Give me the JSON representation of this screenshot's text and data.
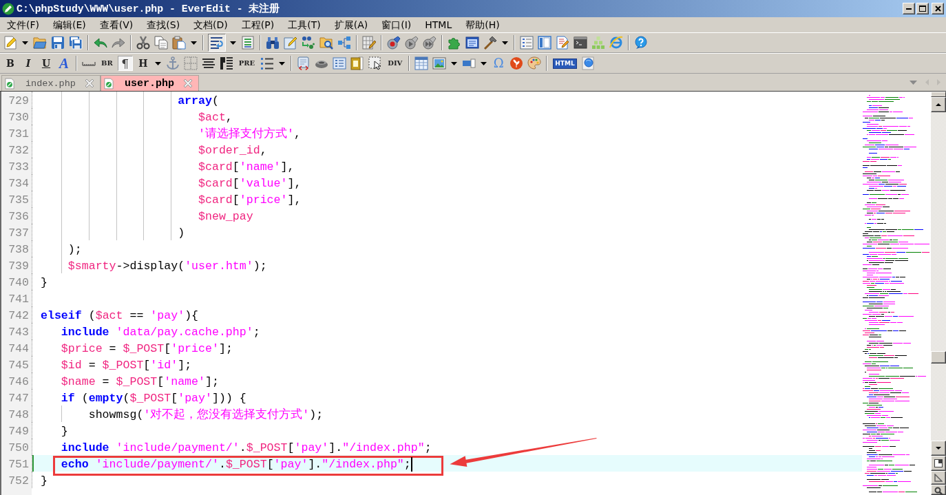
{
  "window": {
    "title": "C:\\phpStudy\\WWW\\user.php - EverEdit - 未注册"
  },
  "menu": [
    "文件(F)",
    "编辑(E)",
    "查看(V)",
    "查找(S)",
    "文档(D)",
    "工程(P)",
    "工具(T)",
    "扩展(A)",
    "窗口(I)",
    "HTML",
    "帮助(H)"
  ],
  "toolbar": {
    "wrap_toggle": {
      "pressed": true
    }
  },
  "format_toolbar": {
    "buttons": [
      {
        "label": "B",
        "pressed": false
      },
      {
        "label": "I",
        "pressed": false
      },
      {
        "label": "U",
        "pressed": false
      },
      {
        "label": "A",
        "pressed": false
      },
      {
        "label": "BR",
        "pressed": false
      },
      {
        "label": "¶",
        "pressed": true
      },
      {
        "label": "H",
        "pressed": false
      },
      {
        "label": "PRE",
        "pressed": false
      },
      {
        "label": "DIV",
        "pressed": false
      },
      {
        "label": "Ω",
        "pressed": false
      },
      {
        "label": "HTML",
        "pressed": false
      }
    ]
  },
  "tabs": [
    {
      "label": "index.php",
      "selected": false
    },
    {
      "label": "user.php",
      "selected": true
    }
  ],
  "editor": {
    "lines": [
      {
        "number": "729",
        "current": false,
        "callout": false,
        "tokens": [
          {
            "kind": "keyword",
            "text": "                    array"
          },
          {
            "kind": "plain",
            "text": "("
          }
        ]
      },
      {
        "number": "730",
        "current": false,
        "callout": false,
        "tokens": [
          {
            "kind": "variable",
            "text": "                       $act"
          },
          {
            "kind": "plain",
            "text": ","
          }
        ]
      },
      {
        "number": "731",
        "current": false,
        "callout": false,
        "tokens": [
          {
            "kind": "string",
            "text": "                       '请选择支付方式'"
          },
          {
            "kind": "plain",
            "text": ","
          }
        ]
      },
      {
        "number": "732",
        "current": false,
        "callout": false,
        "tokens": [
          {
            "kind": "variable",
            "text": "                       $order_id"
          },
          {
            "kind": "plain",
            "text": ","
          }
        ]
      },
      {
        "number": "733",
        "current": false,
        "callout": false,
        "tokens": [
          {
            "kind": "variable",
            "text": "                       $card"
          },
          {
            "kind": "plain",
            "text": "["
          },
          {
            "kind": "string",
            "text": "'name'"
          },
          {
            "kind": "plain",
            "text": "],"
          }
        ]
      },
      {
        "number": "734",
        "current": false,
        "callout": false,
        "tokens": [
          {
            "kind": "variable",
            "text": "                       $card"
          },
          {
            "kind": "plain",
            "text": "["
          },
          {
            "kind": "string",
            "text": "'value'"
          },
          {
            "kind": "plain",
            "text": "],"
          }
        ]
      },
      {
        "number": "735",
        "current": false,
        "callout": false,
        "tokens": [
          {
            "kind": "variable",
            "text": "                       $card"
          },
          {
            "kind": "plain",
            "text": "["
          },
          {
            "kind": "string",
            "text": "'price'"
          },
          {
            "kind": "plain",
            "text": "],"
          }
        ]
      },
      {
        "number": "736",
        "current": false,
        "callout": false,
        "tokens": [
          {
            "kind": "variable",
            "text": "                       $new_pay"
          }
        ]
      },
      {
        "number": "737",
        "current": false,
        "callout": false,
        "tokens": [
          {
            "kind": "plain",
            "text": "                    )"
          }
        ]
      },
      {
        "number": "738",
        "current": false,
        "callout": false,
        "tokens": [
          {
            "kind": "plain",
            "text": "    );"
          }
        ]
      },
      {
        "number": "739",
        "current": false,
        "callout": false,
        "tokens": [
          {
            "kind": "variable",
            "text": "    $smarty"
          },
          {
            "kind": "plain",
            "text": "->display("
          },
          {
            "kind": "string",
            "text": "'user.htm'"
          },
          {
            "kind": "plain",
            "text": ");"
          }
        ]
      },
      {
        "number": "740",
        "current": false,
        "callout": false,
        "tokens": [
          {
            "kind": "plain",
            "text": "}"
          }
        ]
      },
      {
        "number": "741",
        "current": false,
        "callout": false
      },
      {
        "number": "742",
        "current": false,
        "callout": false,
        "tokens": [
          {
            "kind": "keyword",
            "text": "elseif"
          },
          {
            "kind": "plain",
            "text": " ("
          },
          {
            "kind": "variable",
            "text": "$act"
          },
          {
            "kind": "plain",
            "text": " == "
          },
          {
            "kind": "string",
            "text": "'pay'"
          },
          {
            "kind": "plain",
            "text": "){"
          }
        ]
      },
      {
        "number": "743",
        "current": false,
        "callout": false,
        "tokens": [
          {
            "kind": "keyword",
            "text": "   include "
          },
          {
            "kind": "string",
            "text": "'data/pay.cache.php'"
          },
          {
            "kind": "plain",
            "text": ";"
          }
        ]
      },
      {
        "number": "744",
        "current": false,
        "callout": false,
        "tokens": [
          {
            "kind": "variable",
            "text": "   $price"
          },
          {
            "kind": "plain",
            "text": " = "
          },
          {
            "kind": "variable",
            "text": "$_POST"
          },
          {
            "kind": "plain",
            "text": "["
          },
          {
            "kind": "string",
            "text": "'price'"
          },
          {
            "kind": "plain",
            "text": "];"
          }
        ]
      },
      {
        "number": "745",
        "current": false,
        "callout": false,
        "tokens": [
          {
            "kind": "variable",
            "text": "   $id"
          },
          {
            "kind": "plain",
            "text": " = "
          },
          {
            "kind": "variable",
            "text": "$_POST"
          },
          {
            "kind": "plain",
            "text": "["
          },
          {
            "kind": "string",
            "text": "'id'"
          },
          {
            "kind": "plain",
            "text": "];"
          }
        ]
      },
      {
        "number": "746",
        "current": false,
        "callout": false,
        "tokens": [
          {
            "kind": "variable",
            "text": "   $name"
          },
          {
            "kind": "plain",
            "text": " = "
          },
          {
            "kind": "variable",
            "text": "$_POST"
          },
          {
            "kind": "plain",
            "text": "["
          },
          {
            "kind": "string",
            "text": "'name'"
          },
          {
            "kind": "plain",
            "text": "];"
          }
        ]
      },
      {
        "number": "747",
        "current": false,
        "callout": false,
        "tokens": [
          {
            "kind": "keyword",
            "text": "   if"
          },
          {
            "kind": "plain",
            "text": " ("
          },
          {
            "kind": "keyword",
            "text": "empty"
          },
          {
            "kind": "plain",
            "text": "("
          },
          {
            "kind": "variable",
            "text": "$_POST"
          },
          {
            "kind": "plain",
            "text": "["
          },
          {
            "kind": "string",
            "text": "'pay'"
          },
          {
            "kind": "plain",
            "text": "])) {"
          }
        ]
      },
      {
        "number": "748",
        "current": false,
        "callout": false,
        "tokens": [
          {
            "kind": "plain",
            "text": "       showmsg("
          },
          {
            "kind": "string",
            "text": "'对不起，您没有选择支付方式'"
          },
          {
            "kind": "plain",
            "text": ");"
          }
        ]
      },
      {
        "number": "749",
        "current": false,
        "callout": false,
        "tokens": [
          {
            "kind": "plain",
            "text": "   }"
          }
        ]
      },
      {
        "number": "750",
        "current": false,
        "callout": false,
        "tokens": [
          {
            "kind": "keyword",
            "text": "   include "
          },
          {
            "kind": "string",
            "text": "'include/payment/'"
          },
          {
            "kind": "plain",
            "text": "."
          },
          {
            "kind": "variable",
            "text": "$_POST"
          },
          {
            "kind": "plain",
            "text": "["
          },
          {
            "kind": "string",
            "text": "'pay'"
          },
          {
            "kind": "plain",
            "text": "]."
          },
          {
            "kind": "string",
            "text": "\"/index.php\""
          },
          {
            "kind": "plain",
            "text": ";"
          }
        ]
      },
      {
        "number": "751",
        "current": true,
        "callout": true,
        "tokens": [
          {
            "kind": "keyword",
            "text": "   echo "
          },
          {
            "kind": "string",
            "text": "'include/payment/'"
          },
          {
            "kind": "plain",
            "text": "."
          },
          {
            "kind": "variable",
            "text": "$_POST"
          },
          {
            "kind": "plain",
            "text": "["
          },
          {
            "kind": "string",
            "text": "'pay'"
          },
          {
            "kind": "plain",
            "text": "]."
          },
          {
            "kind": "string",
            "text": "\"/index.php\""
          },
          {
            "kind": "plain",
            "text": ";"
          }
        ]
      },
      {
        "number": "752",
        "current": false,
        "callout": false,
        "tokens": [
          {
            "kind": "plain",
            "text": "}"
          }
        ]
      }
    ]
  }
}
